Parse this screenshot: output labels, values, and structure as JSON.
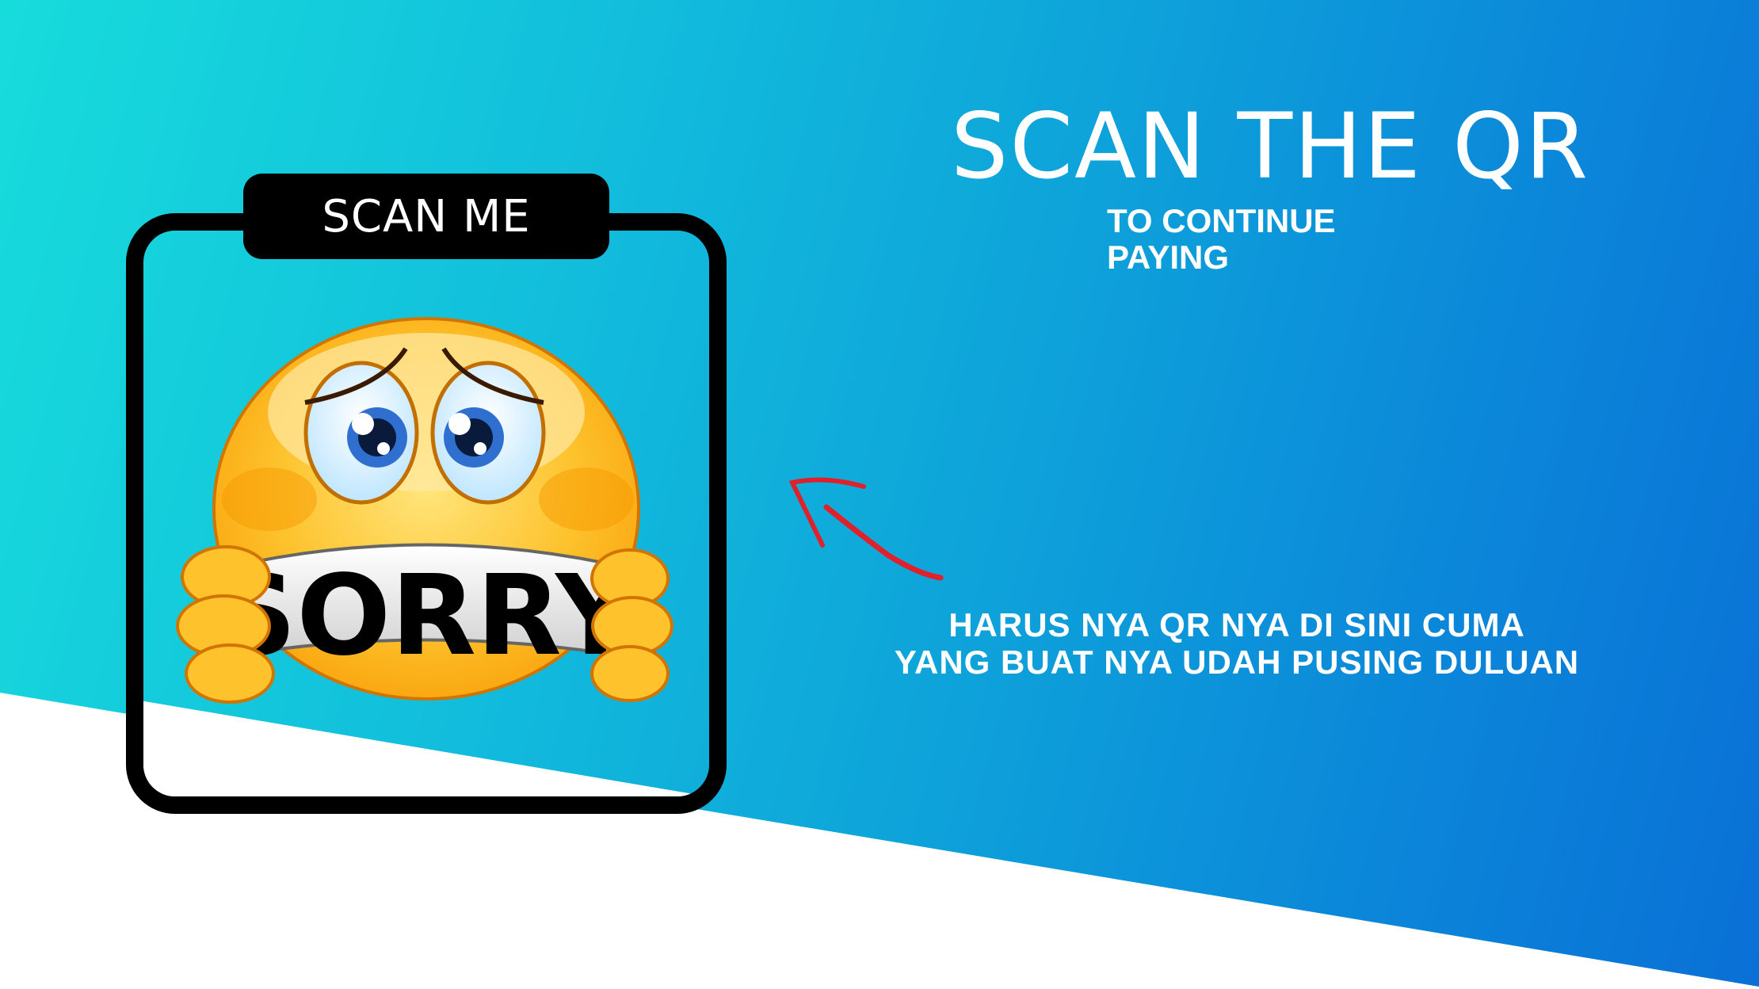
{
  "scan_card": {
    "label": "SCAN ME",
    "sign_text": "SORRY"
  },
  "headline": {
    "title": "SCAN THE QR",
    "subtitle_line1": "TO CONTINUE",
    "subtitle_line2": "PAYING"
  },
  "note": {
    "line1": "HARUS NYA QR NYA DI SINI CUMA",
    "line2": "YANG BUAT NYA UDAH PUSING DULUAN"
  },
  "colors": {
    "gradient_start": "#17dcdc",
    "gradient_end": "#0a70d6",
    "arrow": "#e0202a",
    "frame": "#000000"
  }
}
